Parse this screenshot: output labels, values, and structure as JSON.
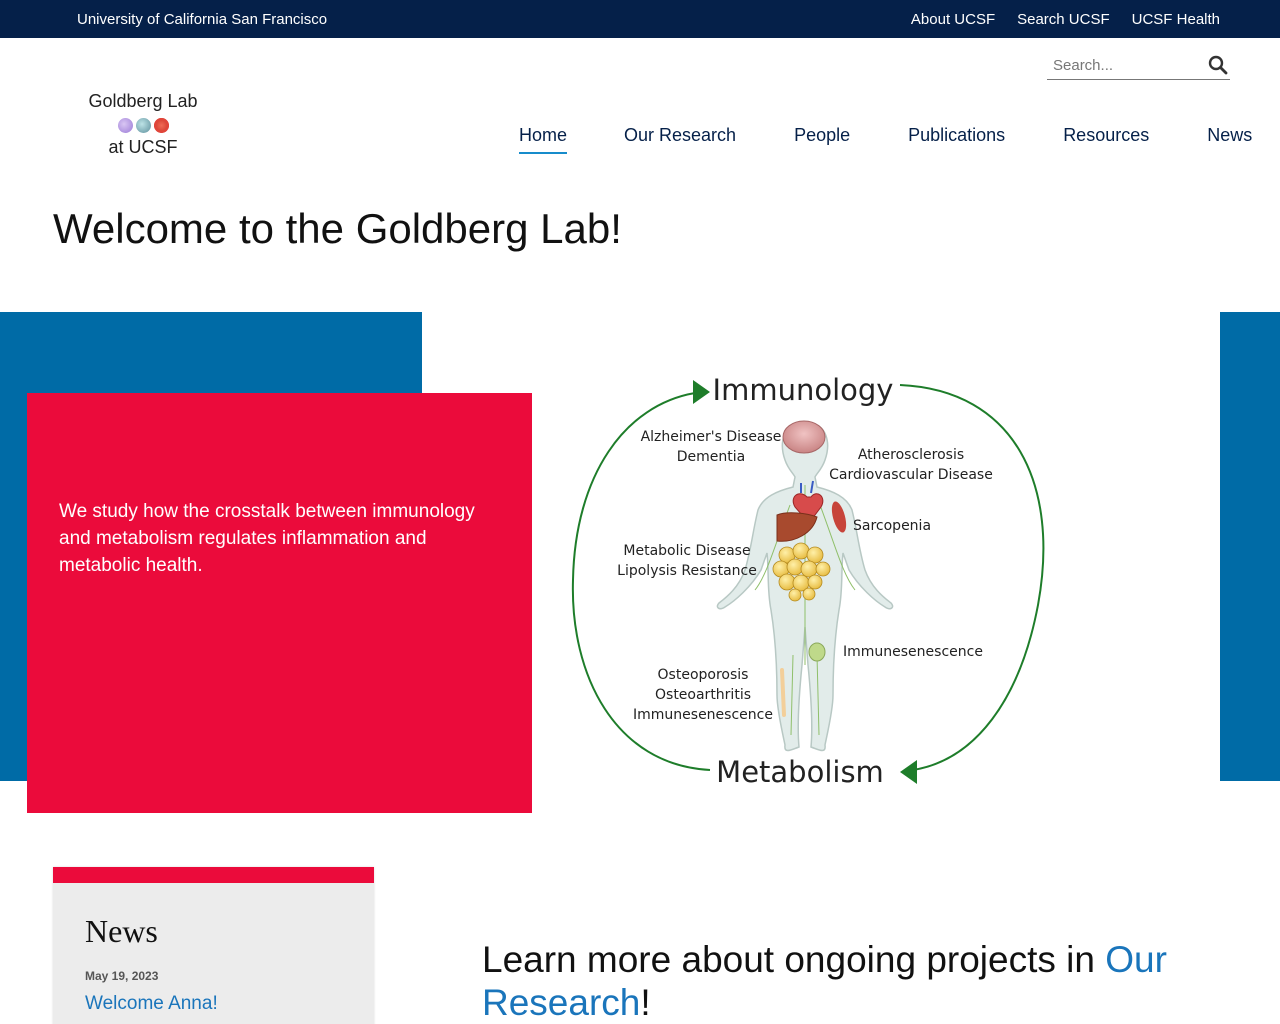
{
  "topbar": {
    "university": "University of California San Francisco",
    "links": [
      "About UCSF",
      "Search UCSF",
      "UCSF Health"
    ]
  },
  "logo": {
    "line1": "Goldberg Lab",
    "line2": "at UCSF"
  },
  "search": {
    "placeholder": "Search..."
  },
  "nav": {
    "items": [
      {
        "label": "Home",
        "active": true
      },
      {
        "label": "Our Research",
        "active": false
      },
      {
        "label": "People",
        "active": false
      },
      {
        "label": "Publications",
        "active": false
      },
      {
        "label": "Resources",
        "active": false
      },
      {
        "label": "News",
        "active": false
      }
    ]
  },
  "page": {
    "title": "Welcome to the Goldberg Lab!"
  },
  "hero": {
    "text": "We study how the crosstalk between immunology and metabolism regulates inflammation and metabolic health."
  },
  "diagram": {
    "top_label": "Immunology",
    "bottom_label": "Metabolism",
    "labels": {
      "alz1": "Alzheimer's Disease",
      "alz2": "Dementia",
      "ath1": "Atherosclerosis",
      "ath2": "Cardiovascular Disease",
      "sarc": "Sarcopenia",
      "met1": "Metabolic Disease",
      "met2": "Lipolysis Resistance",
      "imm_right": "Immunesenescence",
      "ost1": "Osteoporosis",
      "ost2": "Osteoarthritis",
      "ost3": "Immunesenescence"
    }
  },
  "news": {
    "heading": "News",
    "date": "May 19, 2023",
    "item": "Welcome Anna!"
  },
  "learn": {
    "prefix": "Learn more about ongoing projects in ",
    "link": "Our Research",
    "suffix": "!"
  },
  "colors": {
    "navy": "#052049",
    "blue": "#006ba6",
    "red": "#eb0b3b",
    "link": "#1a75bb",
    "green": "#1e7d2a"
  }
}
